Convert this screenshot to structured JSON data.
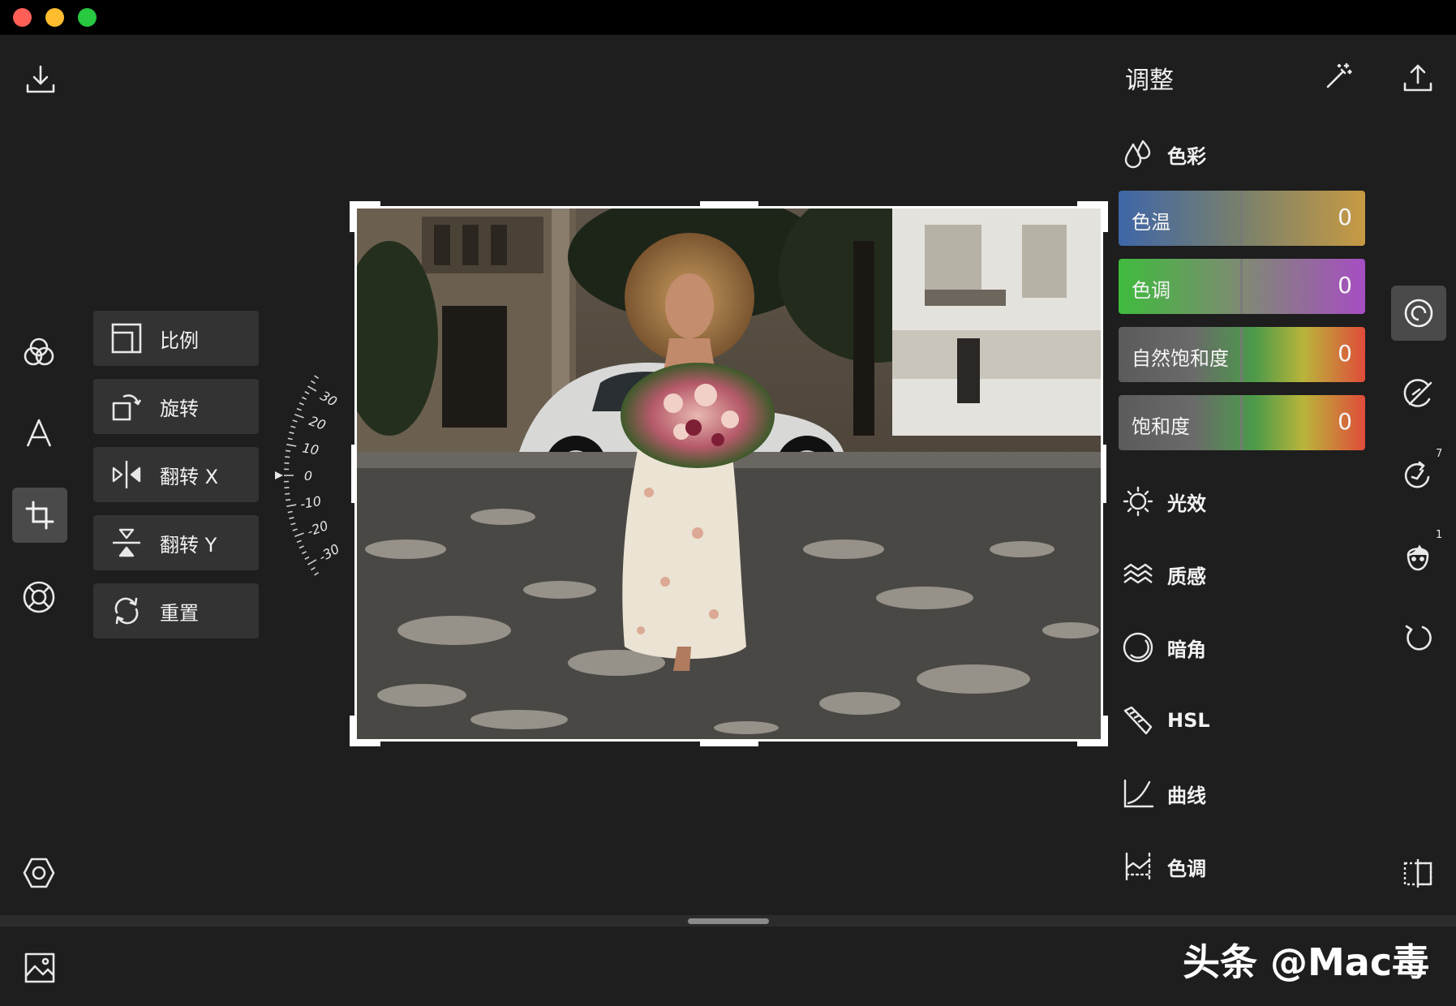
{
  "window": {
    "controls": [
      "close",
      "minimize",
      "zoom"
    ]
  },
  "toolbar_left": {
    "top_icon": "download-icon",
    "tools": [
      "color-filters-icon",
      "text-tool-icon",
      "crop-tool-icon",
      "lifebuoy-icon"
    ],
    "selected_tool": "crop-tool-icon",
    "bottom_icon": "settings-hexagon-icon"
  },
  "crop_menu": {
    "items": [
      {
        "label": "比例",
        "icon": "aspect-ratio-icon"
      },
      {
        "label": "旋转",
        "icon": "rotate-icon"
      },
      {
        "label": "翻转 X",
        "icon": "flip-horizontal-icon"
      },
      {
        "label": "翻转 Y",
        "icon": "flip-vertical-icon"
      },
      {
        "label": "重置",
        "icon": "reset-icon"
      }
    ]
  },
  "rotation_dial": {
    "labels": [
      "-30",
      "-20",
      "-10",
      "0",
      "10",
      "20",
      "30"
    ],
    "current": "0"
  },
  "adjust_panel": {
    "title": "调整",
    "magic_icon": "magic-wand-icon",
    "color_section": {
      "label": "色彩",
      "sliders": [
        {
          "label": "色温",
          "value": "0",
          "colors": [
            "#3e66a8",
            "#c79a43"
          ]
        },
        {
          "label": "色调",
          "value": "0",
          "colors": [
            "#3fbb3d",
            "#a64ec2"
          ]
        },
        {
          "label": "自然饱和度",
          "value": "0",
          "colors": [
            "#5b5b5b",
            "#e04c3a"
          ]
        },
        {
          "label": "饱和度",
          "value": "0",
          "colors": [
            "#5b5b5b",
            "#e04c3a"
          ]
        }
      ]
    },
    "sections": [
      {
        "label": "光效",
        "icon": "sun-icon"
      },
      {
        "label": "质感",
        "icon": "waves-icon"
      },
      {
        "label": "暗角",
        "icon": "vignette-icon"
      },
      {
        "label": "HSL",
        "icon": "hsl-brush-icon"
      },
      {
        "label": "曲线",
        "icon": "curve-icon"
      },
      {
        "label": "色调",
        "icon": "tone-split-icon"
      }
    ]
  },
  "toolbar_right": {
    "top_icon": "export-icon",
    "tools": [
      {
        "icon": "adjust-spiral-icon",
        "badge": ""
      },
      {
        "icon": "brush-mask-icon",
        "badge": ""
      },
      {
        "icon": "history-edit-icon",
        "badge": "7"
      },
      {
        "icon": "face-retouch-icon",
        "badge": "1"
      },
      {
        "icon": "undo-icon",
        "badge": ""
      }
    ],
    "bottom_icon": "compare-split-icon"
  },
  "bottom_bar": {
    "icon": "image-browser-icon"
  },
  "watermark": "头条 @Mac毒"
}
